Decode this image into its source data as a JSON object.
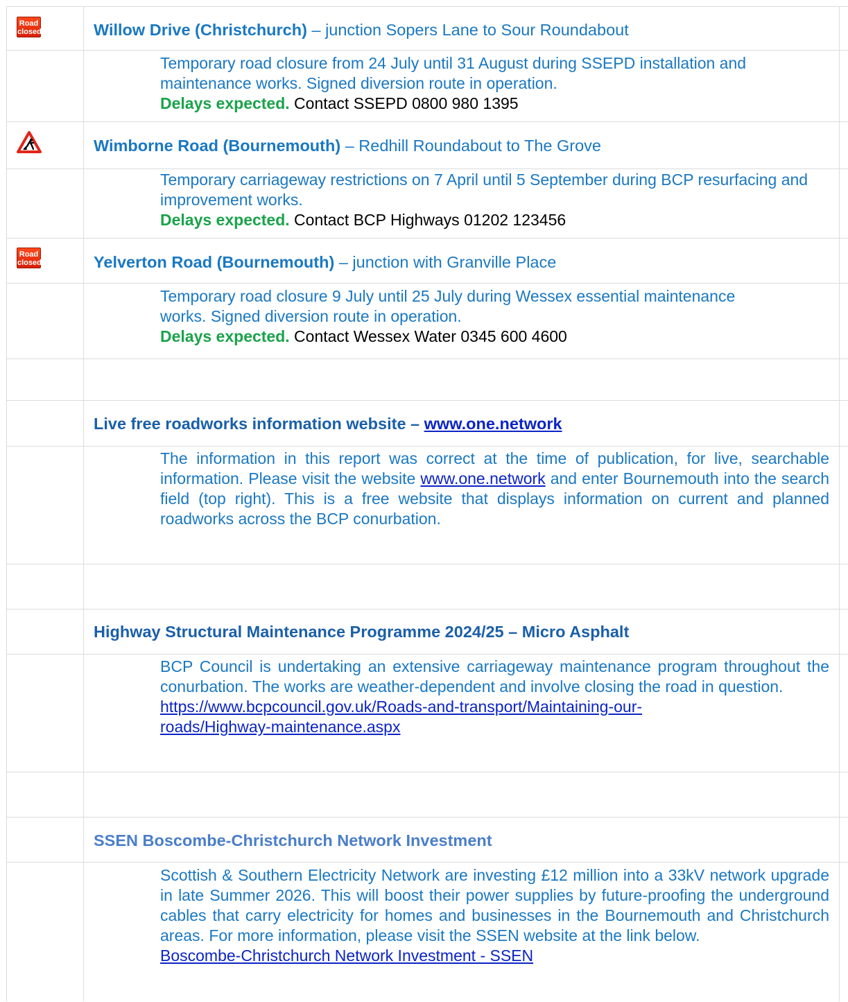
{
  "roadworks": [
    {
      "icon": "road-closed-sign-icon",
      "icon_text": [
        "Road",
        "closed"
      ],
      "road": "Willow Drive (Christchurch)",
      "location": " – junction Sopers Lane to Sour Roundabout",
      "description": "Temporary road closure from 24 July until 31 August during SSEPD installation and maintenance works. Signed diversion route in operation.",
      "delays": "Delays expected.",
      "contact": " Contact SSEPD 0800 980 1395"
    },
    {
      "icon": "roadworks-warning-sign-icon",
      "road": "Wimborne Road (Bournemouth)",
      "location": " – Redhill Roundabout to The Grove",
      "description": "Temporary carriageway restrictions on 7 April until 5 September during BCP resurfacing and improvement works.",
      "delays": "Delays expected.",
      "contact": " Contact BCP Highways 01202 123456"
    },
    {
      "icon": "road-closed-sign-icon",
      "icon_text": [
        "Road",
        "closed"
      ],
      "road": "Yelverton Road (Bournemouth)",
      "location": " – junction with Granville Place",
      "description": "Temporary road closure 9 July until 25 July during Wessex essential maintenance works. Signed diversion route in operation.",
      "delays": "Delays expected.",
      "contact": " Contact Wessex Water 0345 600 4600"
    }
  ],
  "live_info": {
    "heading": "Live free roadworks information website – ",
    "heading_link": "www.one.network",
    "text_before": "The information in this report was correct at the time of publication, for live, searchable information. Please visit the website ",
    "text_link": "www.one.network",
    "text_after": " and enter Bournemouth into the search field (top right). This is a free website that displays information on current and planned roadworks across the BCP conurbation."
  },
  "maintenance": {
    "heading": "Highway Structural Maintenance Programme 2024/25 – Micro Asphalt",
    "text": "BCP Council is undertaking an extensive carriageway maintenance program throughout the conurbation. The works are weather-dependent and involve closing the road in question.",
    "link_line1": "https://www.bcpcouncil.gov.uk/Roads-and-transport/Maintaining-our-",
    "link_line2": "roads/Highway-maintenance.aspx"
  },
  "ssen": {
    "heading": "SSEN Boscombe-Christchurch Network Investment",
    "text": "Scottish & Southern Electricity Network are investing £12 million into a 33kV network upgrade in late Summer 2026. This will boost their power supplies by future-proofing the underground cables that carry electricity for homes and businesses in the Bournemouth and Christchurch areas. For more information, please visit the SSEN website at the link below.",
    "link": "Boscombe-Christchurch Network Investment - SSEN"
  }
}
